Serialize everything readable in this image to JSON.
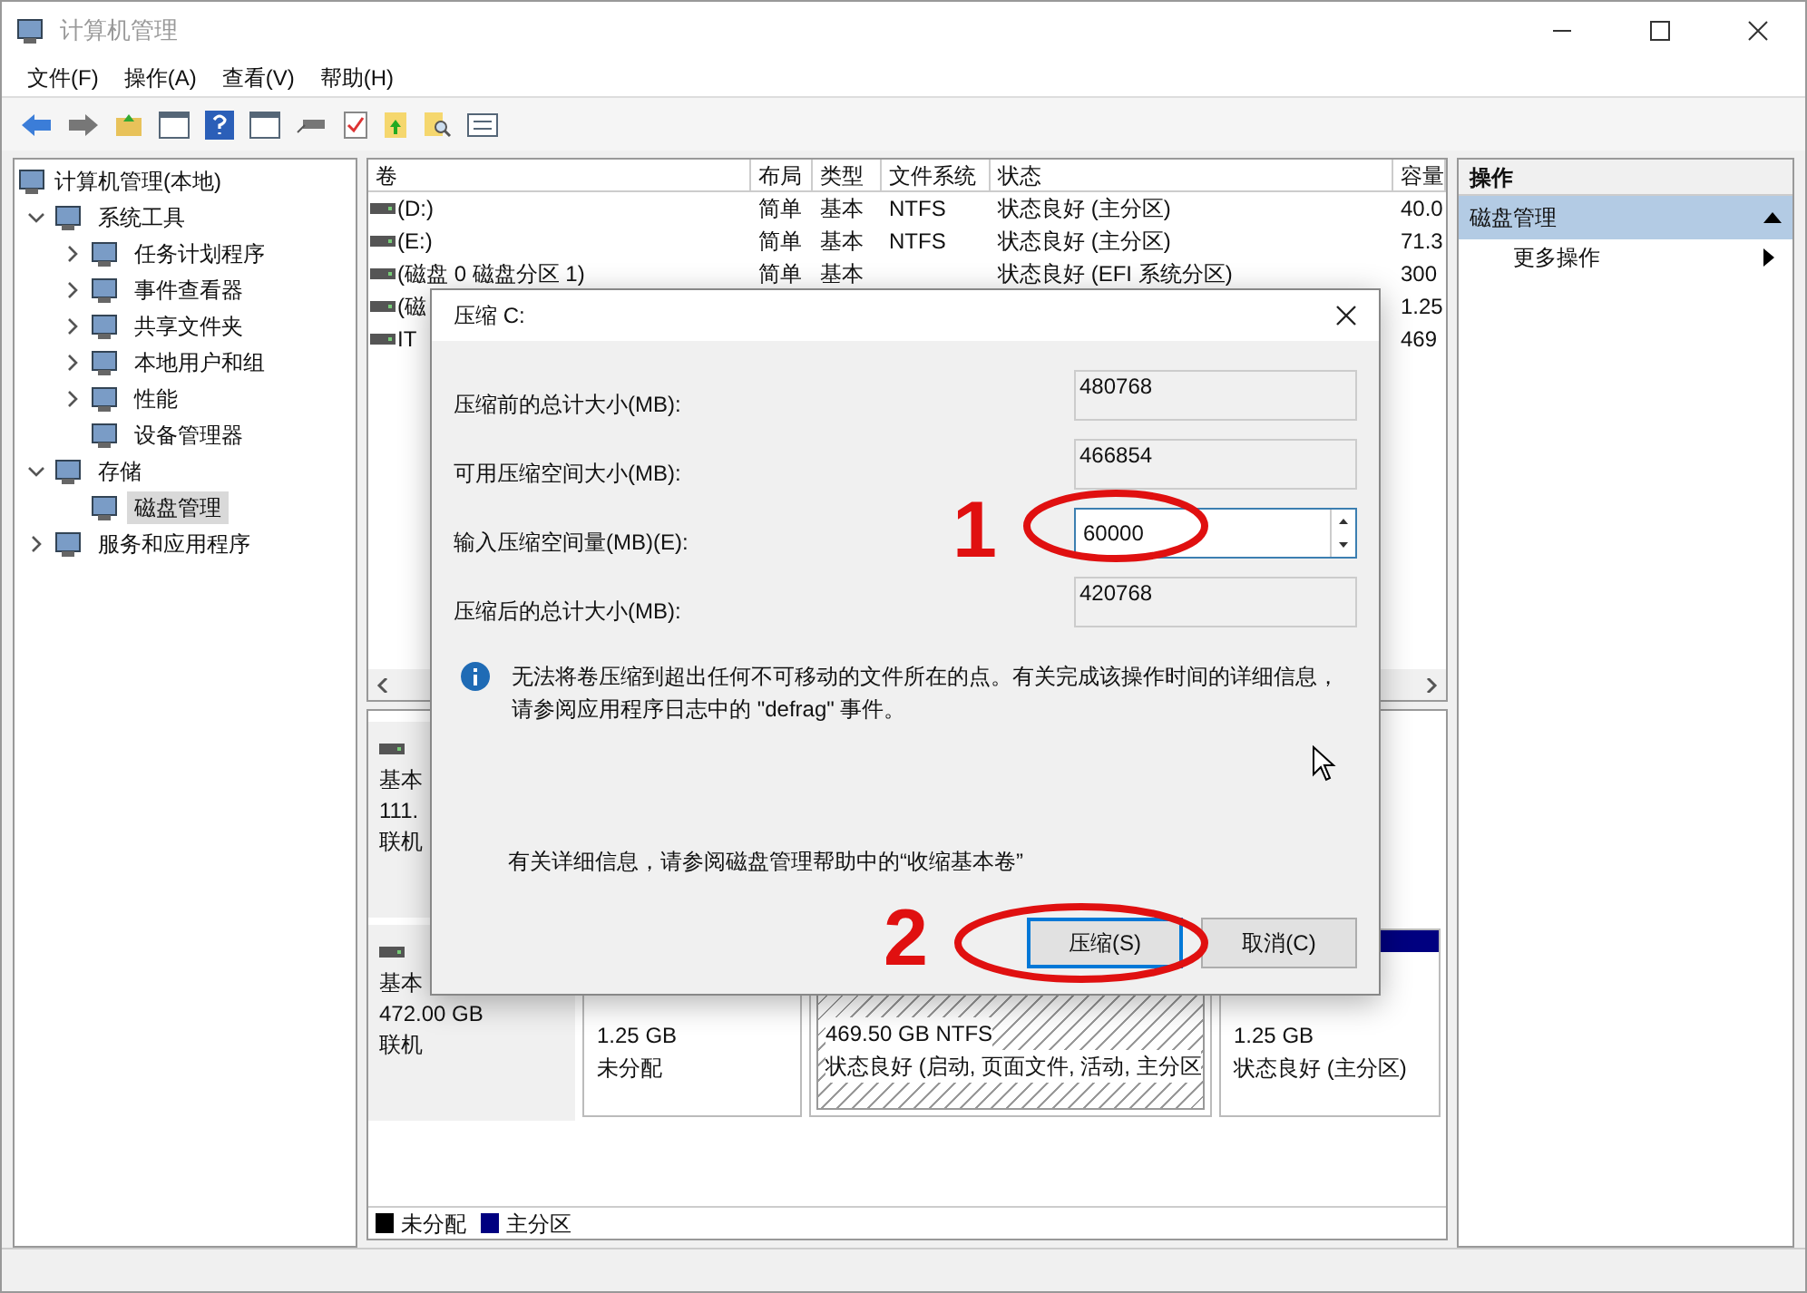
{
  "window": {
    "title": "计算机管理"
  },
  "menu": [
    "文件(F)",
    "操作(A)",
    "查看(V)",
    "帮助(H)"
  ],
  "tree": {
    "root": "计算机管理(本地)",
    "items": [
      {
        "label": "系统工具",
        "kind": "folder",
        "expanded": true,
        "selected": false,
        "children": [
          {
            "label": "任务计划程序",
            "kind": "folder",
            "expanded": false,
            "selected": false
          },
          {
            "label": "事件查看器",
            "kind": "folder",
            "expanded": false,
            "selected": false
          },
          {
            "label": "共享文件夹",
            "kind": "folder",
            "expanded": false,
            "selected": false
          },
          {
            "label": "本地用户和组",
            "kind": "folder",
            "expanded": false,
            "selected": false
          },
          {
            "label": "性能",
            "kind": "folder",
            "expanded": false,
            "selected": false
          },
          {
            "label": "设备管理器",
            "kind": "leaf",
            "selected": false
          }
        ]
      },
      {
        "label": "存储",
        "kind": "folder",
        "expanded": true,
        "selected": false,
        "children": [
          {
            "label": "磁盘管理",
            "kind": "leaf",
            "selected": true
          }
        ]
      },
      {
        "label": "服务和应用程序",
        "kind": "folder",
        "expanded": false,
        "selected": false
      }
    ]
  },
  "volumes": {
    "columns": [
      "卷",
      "布局",
      "类型",
      "文件系统",
      "状态",
      "容量"
    ],
    "rows": [
      {
        "volume": "(D:)",
        "layout": "简单",
        "type": "基本",
        "fs": "NTFS",
        "status": "状态良好 (主分区)",
        "capacity": "40.0"
      },
      {
        "volume": "(E:)",
        "layout": "简单",
        "type": "基本",
        "fs": "NTFS",
        "status": "状态良好 (主分区)",
        "capacity": "71.3"
      },
      {
        "volume": "(磁盘 0 磁盘分区 1)",
        "layout": "简单",
        "type": "基本",
        "status": "状态良好 (EFI 系统分区)",
        "capacity": "300"
      },
      {
        "volume": "(磁",
        "capacity": "1.25"
      },
      {
        "volume": "IT",
        "capacity": "469"
      }
    ]
  },
  "disks": [
    {
      "lines": [
        "基本",
        "111.",
        "联机"
      ]
    },
    {
      "lines": [
        "基本",
        "472.00 GB",
        "联机"
      ],
      "partitions": [
        {
          "kind": "unallocated",
          "size": "1.25 GB",
          "status": "未分配",
          "selected": false
        },
        {
          "kind": "primary",
          "size": "469.50 GB NTFS",
          "status": "状态良好 (启动, 页面文件, 活动, 主分区",
          "selected": true
        },
        {
          "kind": "primary",
          "size": "1.25 GB",
          "status": "状态良好 (主分区)",
          "selected": false
        }
      ]
    }
  ],
  "legend": [
    {
      "label": "未分配",
      "color": "#000000"
    },
    {
      "label": "主分区",
      "color": "#000080"
    }
  ],
  "actions": {
    "title": "操作",
    "section": {
      "label": "磁盘管理",
      "expanded": true
    },
    "items": [
      "更多操作"
    ]
  },
  "dialog": {
    "title": "压缩 C:",
    "fields": [
      {
        "label": "压缩前的总计大小(MB):",
        "value": "480768",
        "kind": "readonly"
      },
      {
        "label": "可用压缩空间大小(MB):",
        "value": "466854",
        "kind": "readonly"
      },
      {
        "label": "输入压缩空间量(MB)(E):",
        "value": "60000",
        "kind": "spin"
      },
      {
        "label": "压缩后的总计大小(MB):",
        "value": "420768",
        "kind": "readonly"
      }
    ],
    "info": "无法将卷压缩到超出任何不可移动的文件所在的点。有关完成该操作时间的详细信息，请参阅应用程序日志中的 \"defrag\" 事件。",
    "help": "有关详细信息，请参阅磁盘管理帮助中的“收缩基本卷”",
    "buttons": [
      {
        "label": "压缩(S)",
        "focused": true
      },
      {
        "label": "取消(C)",
        "focused": false
      }
    ]
  },
  "annotations": [
    "1",
    "2"
  ]
}
